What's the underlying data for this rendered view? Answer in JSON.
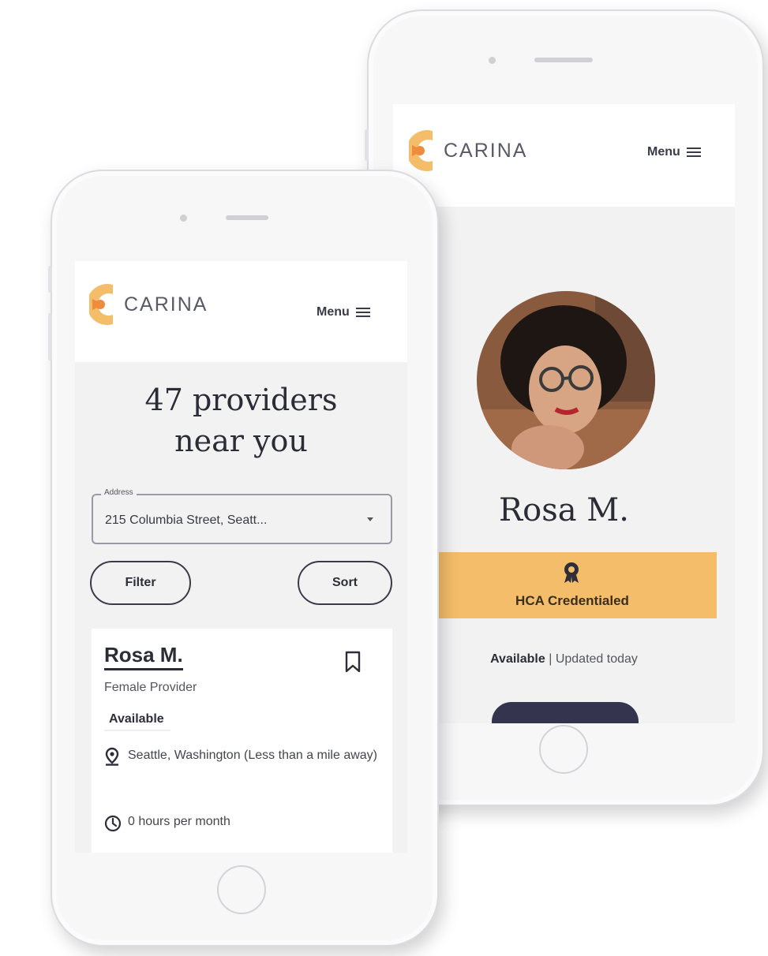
{
  "brand": {
    "name": "CARINA",
    "colors": {
      "orange": "#f08a3c",
      "yellow": "#f4bd6a",
      "navy": "#34344f"
    }
  },
  "header": {
    "menu_label": "Menu",
    "menu_icon": "hamburger-icon"
  },
  "profile_screen": {
    "name": "Rosa M.",
    "credential_icon": "award-badge-icon",
    "credential_label": "HCA Credentialed",
    "availability": "Available",
    "separator": "|",
    "updated": "Updated today"
  },
  "results_screen": {
    "title": "47 providers near you",
    "address": {
      "label": "Address",
      "value": "215 Columbia Street, Seatt..."
    },
    "filter_label": "Filter",
    "sort_label": "Sort",
    "card": {
      "name": "Rosa M.",
      "subtitle": "Female Provider",
      "status": "Available",
      "location": "Seattle, Washington (Less than a mile away)",
      "location_icon": "map-pin-icon",
      "hours": "0 hours per month",
      "hours_icon": "clock-icon",
      "bookmark_icon": "bookmark-icon"
    }
  }
}
